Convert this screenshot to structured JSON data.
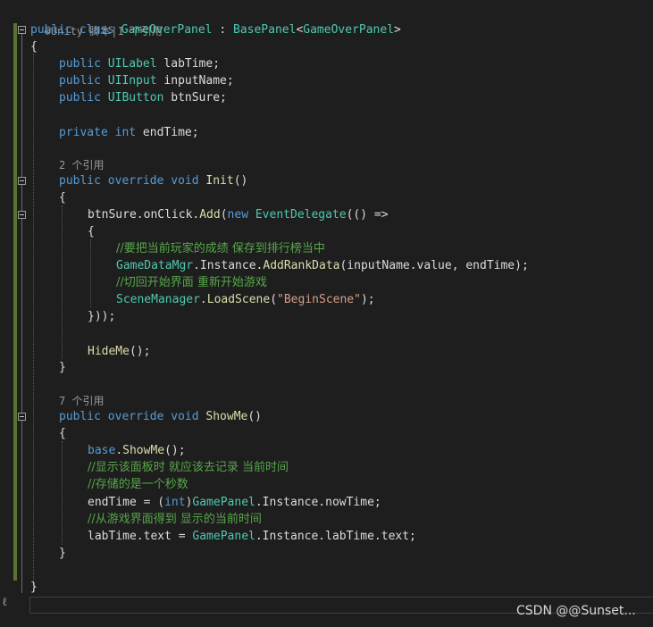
{
  "codelens": {
    "unity_icon": "unity-gear-icon",
    "class_ref": "Unity 脚本|1 个引用",
    "init_ref": "2 个引用",
    "showme_ref": "7 个引用"
  },
  "code": {
    "l_class": [
      "public",
      " ",
      "class",
      " ",
      "GameOverPanel",
      " : ",
      "BasePanel",
      "<",
      "GameOverPanel",
      ">"
    ],
    "l_open1": "{",
    "l_f1": [
      "public",
      " ",
      "UILabel",
      " labTime;"
    ],
    "l_f2": [
      "public",
      " ",
      "UIInput",
      " inputName;"
    ],
    "l_f3": [
      "public",
      " ",
      "UIButton",
      " btnSure;"
    ],
    "l_f4": [
      "private",
      " ",
      "int",
      " endTime;"
    ],
    "l_init": [
      "public",
      " ",
      "override",
      " ",
      "void",
      " ",
      "Init",
      "()"
    ],
    "l_open2": "{",
    "l_add": [
      "btnSure.onClick.",
      "Add",
      "(",
      "new",
      " ",
      "EventDelegate",
      "(() =>"
    ],
    "l_open3": "{",
    "l_c1": "//要把当前玩家的成绩 保存到排行榜当中",
    "l_rank": [
      "GameDataMgr",
      ".Instance.",
      "AddRankData",
      "(inputName.value, endTime);"
    ],
    "l_c2": "//切回开始界面 重新开始游戏",
    "l_load": [
      "SceneManager",
      ".",
      "LoadScene",
      "(",
      "\"BeginScene\"",
      ");"
    ],
    "l_close3": "}));",
    "l_hide": [
      "HideMe",
      "();"
    ],
    "l_close2": "}",
    "l_show": [
      "public",
      " ",
      "override",
      " ",
      "void",
      " ",
      "ShowMe",
      "()"
    ],
    "l_open4": "{",
    "l_base": [
      "base",
      ".",
      "ShowMe",
      "();"
    ],
    "l_c3": "//显示该面板时 就应该去记录 当前时间",
    "l_c4": "//存储的是一个秒数",
    "l_end": [
      "endTime = (",
      "int",
      ")",
      "GamePanel",
      ".Instance.nowTime;"
    ],
    "l_c5": "//从游戏界面得到 显示的当前时间",
    "l_lab": [
      "labTime.text = ",
      "GamePanel",
      ".Instance.labTime.text;"
    ],
    "l_close4": "}",
    "l_close1": "}"
  },
  "watermark": "CSDN @@Sunset...",
  "colors": {
    "background": "#1e1e1e",
    "keyword": "#569cd6",
    "type": "#4ec9b0",
    "method": "#dcdcaa",
    "comment": "#57a64a",
    "string": "#d69d85",
    "text": "#dcdcdc",
    "change_bar": "#577430"
  }
}
